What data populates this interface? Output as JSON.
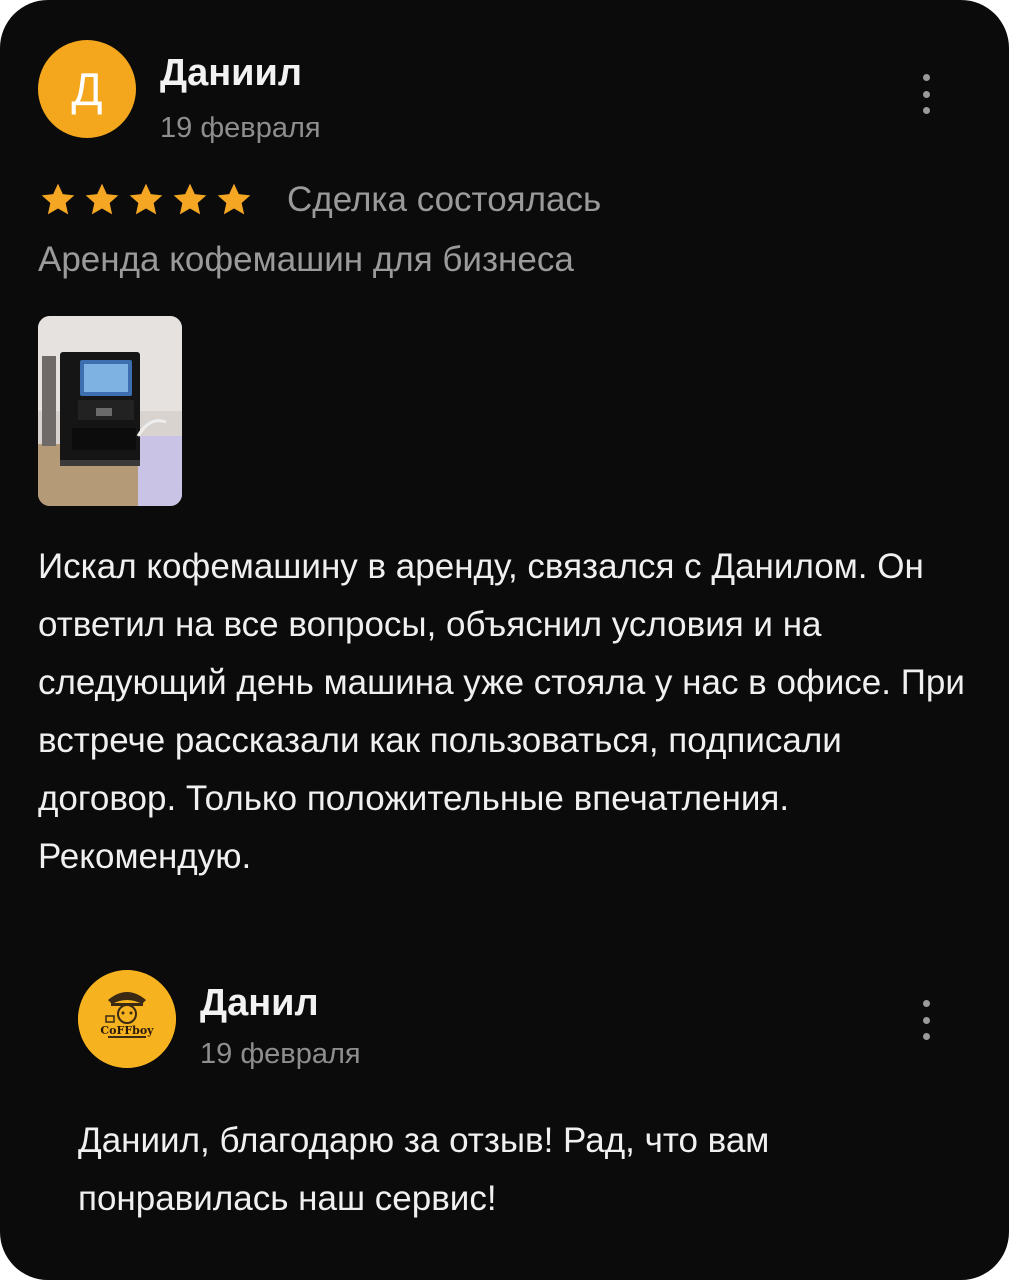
{
  "review": {
    "avatar_letter": "Д",
    "author": "Даниил",
    "date": "19 февраля",
    "rating": 5,
    "deal_status": "Сделка состоялась",
    "service": "Аренда кофемашин для бизнеса",
    "text": "Искал кофемашину в аренду, связался с Данилом. Он ответил на все вопросы, объяснил условия и на следующий день машина уже стояла у нас в офисе. При встрече рассказали как пользоваться, подписали договор. Только положительные впечатления. Рекомендую."
  },
  "reply": {
    "logo_text": "CoFFboy",
    "author": "Данил",
    "date": "19 февраля",
    "text": "Даниил, благодарю за отзыв! Рад, что вам понравилась наш сервис!"
  },
  "colors": {
    "background": "#0b0b0b",
    "star": "#f5a623",
    "avatar": "#f4a61c",
    "muted_text": "#9a9a9a"
  },
  "icons": {
    "menu": "kebab-menu-icon",
    "star": "star-icon"
  }
}
